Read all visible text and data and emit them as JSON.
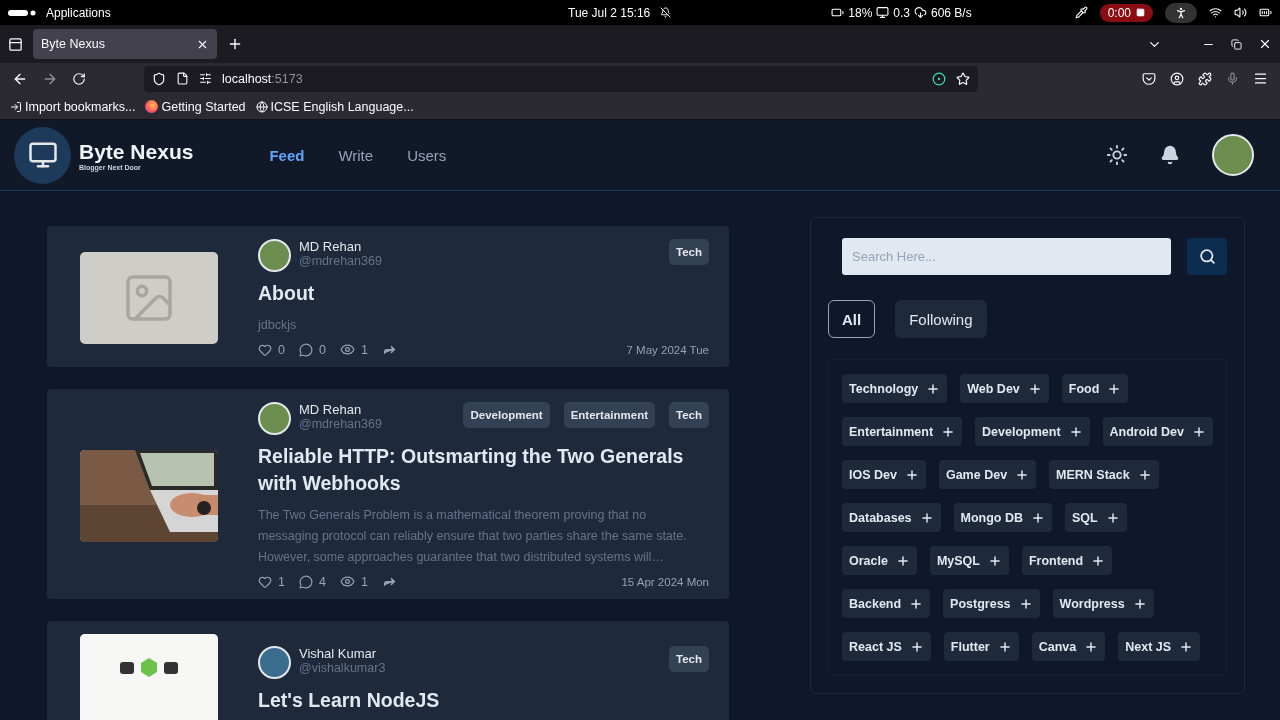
{
  "system_bar": {
    "menu": "Applications",
    "clock": "Tue Jul 2  15:16",
    "battery": "18%",
    "load": "0.3",
    "network": "606 B/s",
    "recording": "0:00"
  },
  "browser": {
    "tabs": [
      {
        "title": "Byte Nexus",
        "selected": true
      }
    ],
    "url_host": "localhost",
    "url_port": ":5173",
    "bookmarks": [
      {
        "label": "Import bookmarks...",
        "kind": "import"
      },
      {
        "label": "Getting Started",
        "kind": "firefox"
      },
      {
        "label": "ICSE English Language...",
        "kind": "globe"
      }
    ]
  },
  "app": {
    "brand": "Byte Nexus",
    "tagline": "Blogger Next Door",
    "nav": [
      {
        "label": "Feed",
        "selected": true
      },
      {
        "label": "Write",
        "selected": false
      },
      {
        "label": "Users",
        "selected": false
      }
    ]
  },
  "posts": [
    {
      "author": "MD Rehan",
      "handle": "@mdrehan369",
      "tags": [
        "Tech"
      ],
      "title": "About",
      "excerpt": "jdbckjs",
      "likes": "0",
      "comments": "0",
      "views": "1",
      "date": "7 May 2024 Tue",
      "kind": "placeholder"
    },
    {
      "author": "MD Rehan",
      "handle": "@mdrehan369",
      "tags": [
        "Development",
        "Entertainment",
        "Tech"
      ],
      "title": "Reliable HTTP: Outsmarting the Two Generals with Webhooks",
      "excerpt": "The Two Generals Problem is a mathematical theorem proving that no messaging protocol can reliably ensure that two parties share the same state. However, some approaches guarantee that two distributed systems will…",
      "likes": "1",
      "comments": "4",
      "views": "1",
      "date": "15 Apr 2024 Mon",
      "kind": "picture"
    },
    {
      "author": "Vishal Kumar",
      "handle": "@vishalkumar3",
      "tags": [
        "Tech"
      ],
      "title": "Let's Learn NodeJS",
      "kind": "picture"
    }
  ],
  "sidebar": {
    "search_placeholder": "Search Here...",
    "filters": [
      {
        "label": "All",
        "selected": true
      },
      {
        "label": "Following",
        "selected": false
      }
    ],
    "topics": [
      "Technology",
      "Web Dev",
      "Food",
      "Entertainment",
      "Development",
      "Android Dev",
      "IOS Dev",
      "Game Dev",
      "MERN Stack",
      "Databases",
      "Mongo DB",
      "SQL",
      "Oracle",
      "MySQL",
      "Frontend",
      "Backend",
      "Postgress",
      "Wordpress",
      "React JS",
      "Flutter",
      "Canva",
      "Next JS"
    ]
  }
}
